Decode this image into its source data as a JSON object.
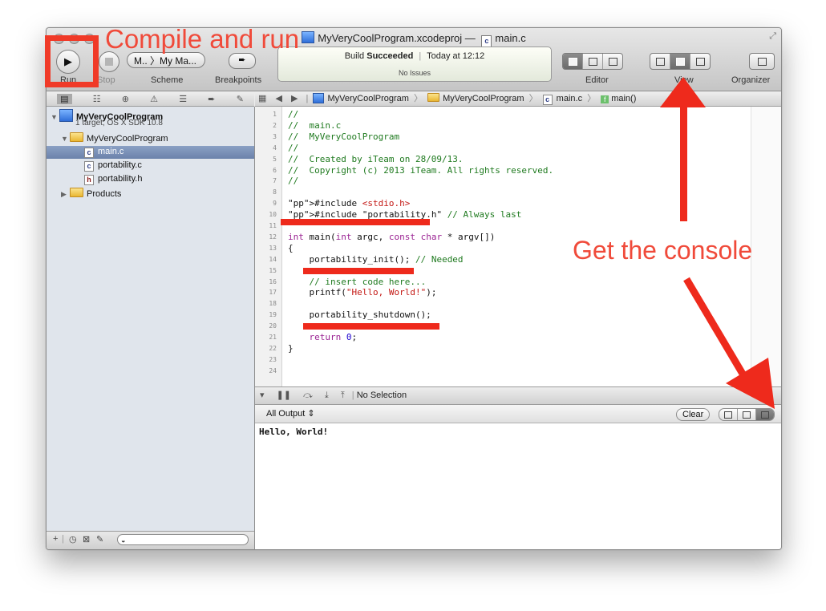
{
  "window": {
    "title_project": "MyVeryCoolProgram.xcodeproj",
    "title_sep": "—",
    "title_file": "main.c"
  },
  "toolbar": {
    "run_label": "Run",
    "stop_label": "Stop",
    "scheme_label": "Scheme",
    "scheme_value": "M.. 〉My Ma...",
    "breakpoints_label": "Breakpoints",
    "editor_label": "Editor",
    "view_label": "View",
    "organizer_label": "Organizer"
  },
  "activity": {
    "build_prefix": "Build",
    "build_status": "Succeeded",
    "time": "Today at 12:12",
    "issues": "No Issues"
  },
  "navigator": {
    "project_name": "MyVeryCoolProgram",
    "project_sub": "1 target, OS X SDK 10.8",
    "group": "MyVeryCoolProgram",
    "files": [
      {
        "name": "main.c",
        "type": "c"
      },
      {
        "name": "portability.c",
        "type": "c"
      },
      {
        "name": "portability.h",
        "type": "h"
      }
    ],
    "products": "Products"
  },
  "jumpbar": {
    "project": "MyVeryCoolProgram",
    "group": "MyVeryCoolProgram",
    "file": "main.c",
    "symbol": "main()"
  },
  "code": {
    "lines": [
      "//",
      "//  main.c",
      "//  MyVeryCoolProgram",
      "//",
      "//  Created by iTeam on 28/09/13.",
      "//  Copyright (c) 2013 iTeam. All rights reserved.",
      "//",
      "",
      "#include <stdio.h>",
      "#include \"portability.h\" // Always last",
      "",
      "int main(int argc, const char * argv[])",
      "{",
      "    portability_init(); // Needed",
      "",
      "    // insert code here...",
      "    printf(\"Hello, World!\");",
      "",
      "    portability_shutdown();",
      "",
      "    return 0;",
      "}",
      "",
      ""
    ]
  },
  "debug": {
    "selection": "No Selection"
  },
  "console": {
    "filter": "All Output ⇕",
    "clear_label": "Clear",
    "output": "Hello, World!"
  },
  "annotations": {
    "compile": "Compile and run",
    "console_hint": "Get the console",
    "color": "#f04a3a"
  }
}
